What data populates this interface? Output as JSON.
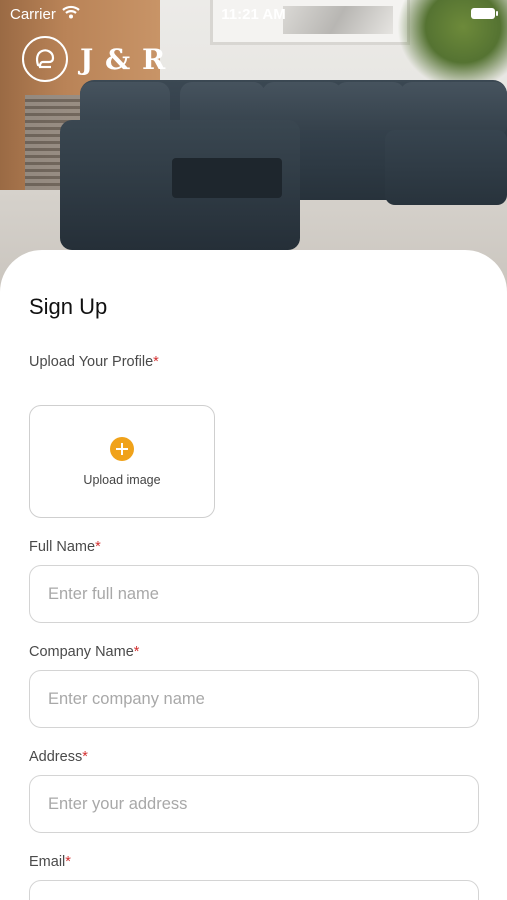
{
  "status_bar": {
    "carrier": "Carrier",
    "time": "11:21 AM"
  },
  "header": {
    "brand": "J & R",
    "logo_icon": "armchair-icon",
    "background_image": "dark-grey-sectional-sofa-photo"
  },
  "form": {
    "title": "Sign Up",
    "profile_label": "Upload Your Profile",
    "upload_label": "Upload image",
    "upload_icon": "plus-circle-icon",
    "required_marker": "*",
    "fields": [
      {
        "label": "Full Name",
        "placeholder": "Enter full name",
        "value": ""
      },
      {
        "label": "Company Name",
        "placeholder": "Enter company name",
        "value": ""
      },
      {
        "label": "Address",
        "placeholder": "Enter your address",
        "value": ""
      },
      {
        "label": "Email",
        "placeholder": "",
        "value": ""
      }
    ]
  },
  "colors": {
    "accent": "#f0a21a",
    "required": "#d32f2f",
    "field_border": "#d4d4d4",
    "sofa": "#2f3b45"
  }
}
